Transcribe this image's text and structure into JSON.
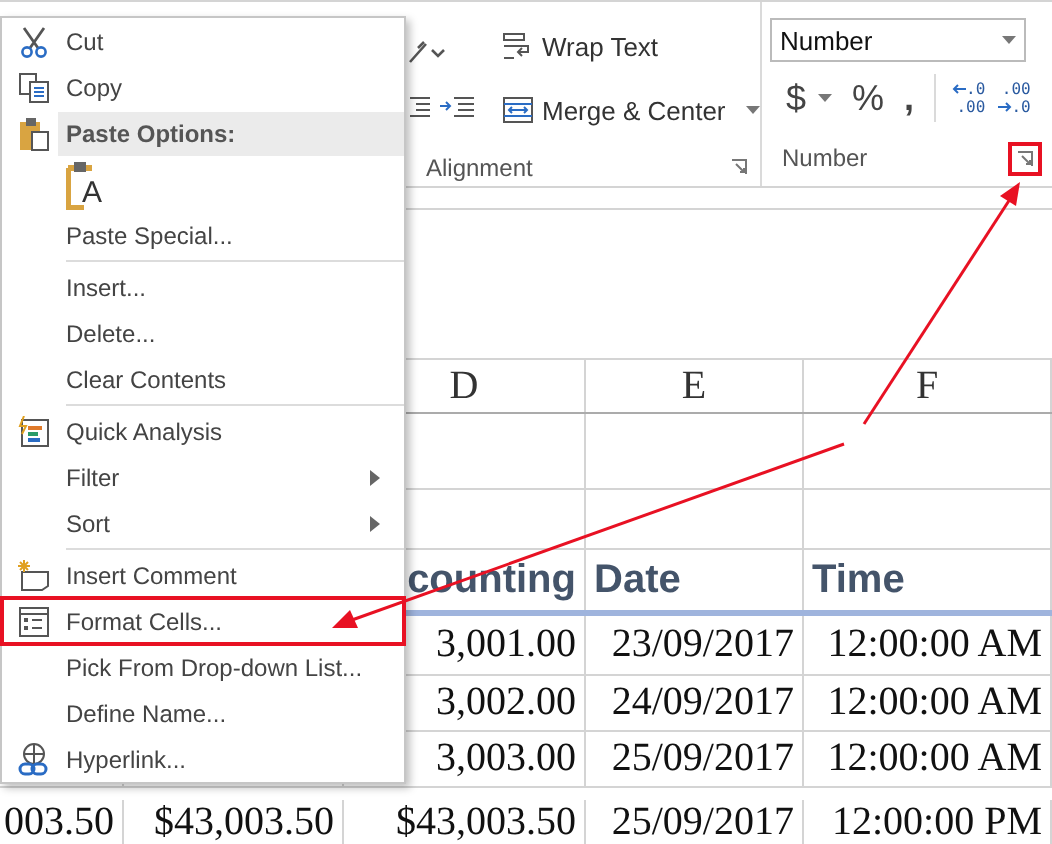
{
  "context_menu": {
    "items": [
      {
        "kind": "item",
        "label": "Cut",
        "boxed": false
      },
      {
        "kind": "item",
        "label": "Copy",
        "boxed": false
      },
      {
        "kind": "header",
        "label": "Paste Options:"
      },
      {
        "kind": "paste-option",
        "glyph": "A"
      },
      {
        "kind": "item",
        "label": "Paste Special...",
        "boxed": false
      },
      {
        "kind": "separator"
      },
      {
        "kind": "item",
        "label": "Insert...",
        "boxed": false
      },
      {
        "kind": "item",
        "label": "Delete...",
        "boxed": false
      },
      {
        "kind": "item",
        "label": "Clear Contents",
        "boxed": false
      },
      {
        "kind": "separator"
      },
      {
        "kind": "item",
        "label": "Quick Analysis",
        "boxed": false
      },
      {
        "kind": "submenu",
        "label": "Filter",
        "boxed": false
      },
      {
        "kind": "submenu",
        "label": "Sort",
        "boxed": false
      },
      {
        "kind": "separator"
      },
      {
        "kind": "item",
        "label": "Insert Comment",
        "boxed": false
      },
      {
        "kind": "item",
        "label": "Format Cells...",
        "boxed": true
      },
      {
        "kind": "item",
        "label": "Pick From Drop-down List...",
        "boxed": false
      },
      {
        "kind": "item",
        "label": "Define Name...",
        "boxed": false
      },
      {
        "kind": "item",
        "label": "Hyperlink...",
        "boxed": false
      }
    ]
  },
  "ribbon": {
    "alignment_group": {
      "label": "Alignment",
      "launcher_boxed": false,
      "buttons": [
        {
          "label": "Wrap Text"
        },
        {
          "label": "Merge & Center"
        }
      ]
    },
    "number_group": {
      "label": "Number",
      "launcher_boxed": true,
      "format_field": {
        "value": "Number"
      },
      "symbols": [
        "$",
        "%",
        ","
      ],
      "decimal_buttons": [
        {
          "top": ".0",
          "bottom": ".00"
        },
        {
          "top": ".00",
          "bottom": ".0"
        }
      ]
    }
  },
  "sheet": {
    "columns": [
      "D",
      "E",
      "F"
    ],
    "rows": [
      {
        "kind": "blank"
      },
      {
        "kind": "blank"
      },
      {
        "kind": "header",
        "cells": [
          "counting",
          "Date",
          "Time"
        ]
      },
      {
        "kind": "data",
        "cells": [
          "3,001.00",
          "23/09/2017",
          "12:00:00 AM"
        ]
      },
      {
        "kind": "data",
        "cells": [
          "3,002.00",
          "24/09/2017",
          "12:00:00 AM"
        ]
      },
      {
        "kind": "data",
        "cells": [
          "3,003.00",
          "25/09/2017",
          "12:00:00 AM"
        ]
      },
      {
        "kind": "data",
        "cells": [
          "003.50",
          "$43,003.50",
          "$43,003.50",
          "25/09/2017",
          "12:00:00 PM"
        ]
      }
    ]
  }
}
